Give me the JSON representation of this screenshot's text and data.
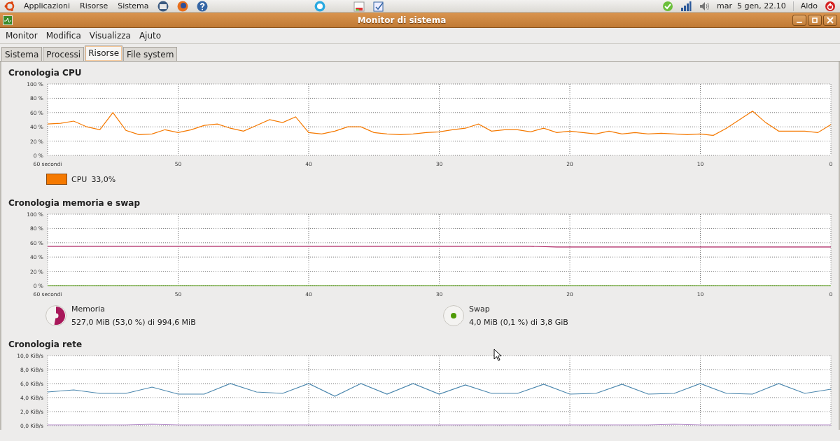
{
  "top_panel": {
    "menus": [
      "Applicazioni",
      "Risorse",
      "Sistema"
    ],
    "clock": "mar  5 gen, 22.10",
    "user": "Aldo"
  },
  "window": {
    "title": "Monitor di sistema"
  },
  "menu_bar": [
    "Monitor",
    "Modifica",
    "Visualizza",
    "Ajuto"
  ],
  "tabs": [
    {
      "label": "Sistema",
      "selected": false
    },
    {
      "label": "Processi",
      "selected": false
    },
    {
      "label": "Risorse",
      "selected": true
    },
    {
      "label": "File system",
      "selected": false
    }
  ],
  "sections": [
    {
      "title": "Cronologia CPU",
      "chart_data": {
        "type": "line",
        "xlim": [
          60,
          0
        ],
        "ylim": [
          0,
          100
        ],
        "grid": true,
        "xticks": [
          {
            "value": 60,
            "label": "60 secondi"
          },
          50,
          40,
          30,
          20,
          10,
          0
        ],
        "yticks": [
          {
            "value": 0,
            "label": "0 %"
          },
          {
            "value": 20,
            "label": "20 %"
          },
          {
            "value": 40,
            "label": "40 %"
          },
          {
            "value": 60,
            "label": "60 %"
          },
          {
            "value": 80,
            "label": "80 %"
          },
          {
            "value": 100,
            "label": "100 %"
          }
        ],
        "x": [
          60,
          59,
          58,
          57,
          56,
          55,
          54,
          53,
          52,
          51,
          50,
          49,
          48,
          47,
          46,
          45,
          44,
          43,
          42,
          41,
          40,
          39,
          38,
          37,
          36,
          35,
          34,
          33,
          32,
          31,
          30,
          29,
          28,
          27,
          26,
          25,
          24,
          23,
          22,
          21,
          20,
          19,
          18,
          17,
          16,
          15,
          14,
          13,
          12,
          11,
          10,
          9,
          8,
          7,
          6,
          5,
          4,
          3,
          2,
          1,
          0
        ],
        "series": [
          {
            "color": "#f57900",
            "values": [
              44,
              45,
              48,
              40,
              36,
              60,
              35,
              29,
              30,
              36,
              32,
              36,
              42,
              44,
              38,
              34,
              42,
              50,
              46,
              54,
              32,
              30,
              34,
              40,
              40,
              32,
              30,
              29,
              30,
              32,
              33,
              36,
              38,
              44,
              34,
              36,
              36,
              33,
              38,
              32,
              34,
              32,
              30,
              34,
              30,
              32,
              30,
              31,
              30,
              29,
              30,
              28,
              38,
              50,
              62,
              46,
              34,
              34,
              34,
              32,
              43
            ]
          }
        ]
      },
      "legend": [
        {
          "kind": "swatch",
          "color": "#f57900",
          "label": "CPU",
          "value": "33,0%"
        }
      ]
    },
    {
      "title": "Cronologia memoria e swap",
      "chart_data": {
        "type": "line",
        "xlim": [
          60,
          0
        ],
        "ylim": [
          0,
          100
        ],
        "grid": true,
        "xticks": [
          {
            "value": 60,
            "label": "60 secondi"
          },
          50,
          40,
          30,
          20,
          10,
          0
        ],
        "yticks": [
          {
            "value": 0,
            "label": "0 %"
          },
          {
            "value": 20,
            "label": "20 %"
          },
          {
            "value": 40,
            "label": "40 %"
          },
          {
            "value": 60,
            "label": "60 %"
          },
          {
            "value": 80,
            "label": "80 %"
          },
          {
            "value": 100,
            "label": "100 %"
          }
        ],
        "x": [
          60,
          40,
          23,
          21,
          0
        ],
        "series": [
          {
            "color": "#a8185a",
            "values": [
              55,
              55,
              55,
              54,
              54
            ]
          },
          {
            "color": "#4e9a06",
            "values": [
              0,
              0,
              0,
              0,
              0
            ]
          }
        ]
      },
      "legend": [
        {
          "kind": "pie",
          "color": "#a8185a",
          "label": "Memoria",
          "value": "527,0 MiB (53,0 %) di 994,6 MiB",
          "level": 0.53
        },
        {
          "kind": "dot",
          "color": "#4e9a06",
          "label": "Swap",
          "value": "4,0 MiB (0,1 %) di 3,8 GiB"
        }
      ]
    },
    {
      "title": "Cronologia rete",
      "chart_data": {
        "type": "line",
        "xlim": [
          60,
          0
        ],
        "ylim": [
          0,
          10
        ],
        "grid": true,
        "yticks": [
          {
            "value": 0,
            "label": "0,0 KiB/s"
          },
          {
            "value": 2,
            "label": "2,0 KiB/s"
          },
          {
            "value": 4,
            "label": "4,0 KiB/s"
          },
          {
            "value": 6,
            "label": "6,0 KiB/s"
          },
          {
            "value": 8,
            "label": "8,0 KiB/s"
          },
          {
            "value": 10,
            "label": "10,0 KiB/s"
          }
        ],
        "x": [
          60,
          58,
          56,
          54,
          52,
          50,
          48,
          46,
          44,
          42,
          40,
          38,
          36,
          34,
          32,
          30,
          28,
          26,
          24,
          22,
          20,
          18,
          16,
          14,
          12,
          10,
          8,
          6,
          4,
          2,
          0
        ],
        "series": [
          {
            "color": "#4a86ad",
            "values": [
              4.8,
              5.1,
              4.6,
              4.6,
              5.5,
              4.5,
              4.5,
              6,
              4.8,
              4.6,
              6,
              4.2,
              6,
              4.5,
              6,
              4.5,
              5.8,
              4.6,
              4.6,
              5.9,
              4.5,
              4.6,
              5.9,
              4.5,
              4.6,
              6,
              4.6,
              4.5,
              6,
              4.6,
              5.2
            ]
          },
          {
            "color": "#b48cc8",
            "values": [
              0.1,
              0.1,
              0.1,
              0.1,
              0.2,
              0.1,
              0.1,
              0.1,
              0.1,
              0.1,
              0.1,
              0.1,
              0.1,
              0.1,
              0.1,
              0.1,
              0.1,
              0.1,
              0.1,
              0.1,
              0.1,
              0.1,
              0.1,
              0.1,
              0.2,
              0.1,
              0.1,
              0.1,
              0.1,
              0.1,
              0.1
            ]
          }
        ]
      }
    }
  ]
}
